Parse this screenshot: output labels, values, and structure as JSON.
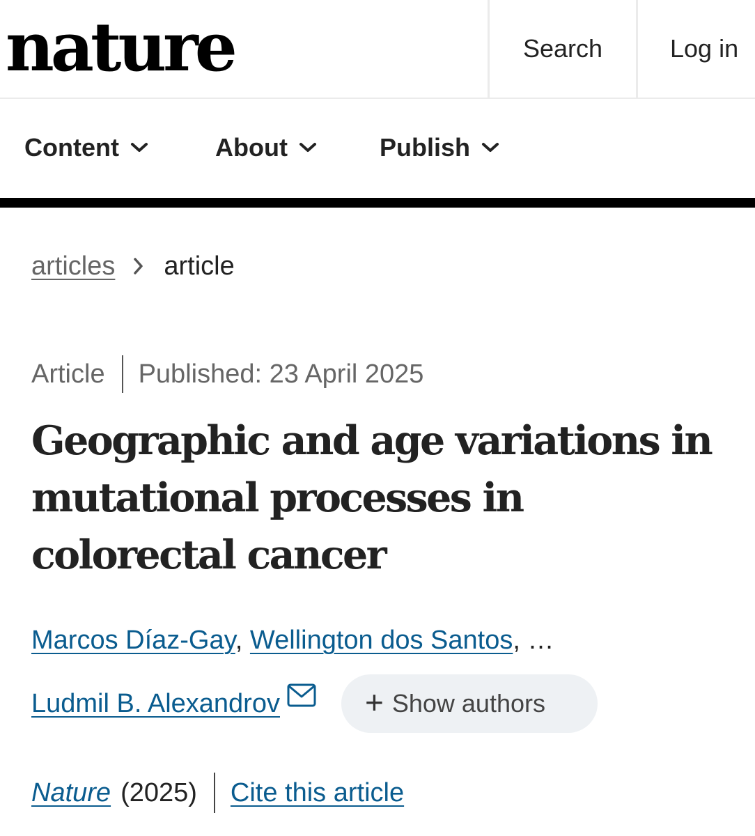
{
  "header": {
    "logo": "nature",
    "search_label": "Search",
    "login_label": "Log in"
  },
  "nav": {
    "items": [
      {
        "label": "Content"
      },
      {
        "label": "About"
      },
      {
        "label": "Publish"
      }
    ]
  },
  "breadcrumb": {
    "parent": "articles",
    "current": "article"
  },
  "article": {
    "type": "Article",
    "published": "Published: 23 April 2025",
    "title": "Geographic and age variations in mutational processes in colorectal cancer",
    "authors": [
      "Marcos Díaz-Gay",
      "Wellington dos Santos"
    ],
    "author_sep": ",",
    "ellipsis": "…",
    "last_author": "Ludmil B. Alexandrov",
    "show_authors_label": "Show authors",
    "journal": "Nature",
    "year": "(2025)",
    "cite_label": "Cite this article"
  },
  "colors": {
    "link": "#0a5c8f",
    "muted": "#666666",
    "text": "#222222",
    "pill_bg": "#eef1f4"
  },
  "icons": {
    "nav_chevron": "chevron-down-icon",
    "breadcrumb_sep": "chevron-right-icon",
    "mail": "envelope-icon",
    "expand": "plus-icon"
  }
}
